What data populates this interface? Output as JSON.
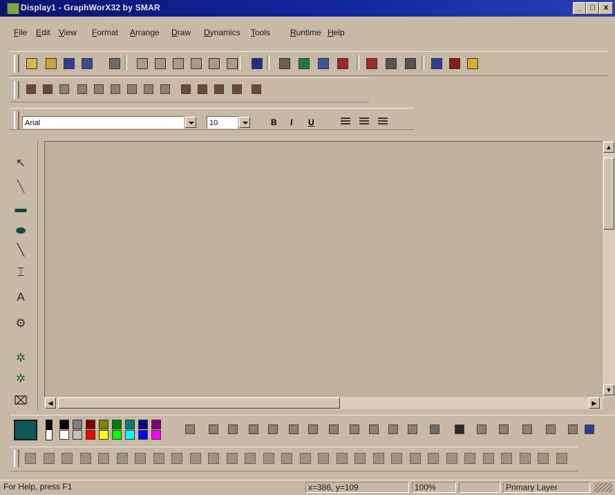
{
  "window": {
    "title": "Display1 - GraphWorX32 by SMAR",
    "buttons": {
      "minimize": "_",
      "maximize": "□",
      "close": "x"
    }
  },
  "menu": [
    {
      "label": "File",
      "ul": "F",
      "rest": "ile"
    },
    {
      "label": "Edit",
      "ul": "E",
      "rest": "dit"
    },
    {
      "label": "View",
      "ul": "V",
      "rest": "iew"
    },
    {
      "label": "Format",
      "ul": "F",
      "rest": "ormat"
    },
    {
      "label": "Arrange",
      "ul": "A",
      "rest": "rrange"
    },
    {
      "label": "Draw",
      "ul": "D",
      "rest": "raw"
    },
    {
      "label": "Dynamics",
      "ul": "D",
      "rest": "ynamics"
    },
    {
      "label": "Tools",
      "ul": "T",
      "rest": "ools"
    },
    {
      "label": "Runtime",
      "ul": "R",
      "rest": "untime"
    },
    {
      "label": "Help",
      "ul": "H",
      "rest": "elp"
    }
  ],
  "toolbars": {
    "standard": [
      "new-icon",
      "open-icon",
      "save-icon",
      "save-as-icon",
      "print-icon",
      "cut-icon",
      "copy-icon",
      "paste-icon",
      "paste-special-icon",
      "undo-icon",
      "redo-icon",
      "pointer-help-icon",
      "object-icon",
      "bar-chart-icon",
      "trend-icon",
      "alarm-icon",
      "gauge-icon",
      "switch-icon",
      "panel-icon",
      "runtime-icon",
      "display-icon",
      "lock-icon"
    ],
    "arrange": [
      "group-icon",
      "ungroup-icon",
      "align-icon",
      "front-icon",
      "back-icon",
      "flip-h-icon",
      "flip-v-icon",
      "rotate-icon",
      "rotate-left-icon",
      "pick-icon",
      "pick-2-icon",
      "layer-icon",
      "clear-icon",
      "grid-icon"
    ],
    "font": {
      "name": "Arial",
      "size": "10",
      "bold": "B",
      "italic": "I",
      "underline": "U"
    }
  },
  "palette": [
    "select-arrow-icon",
    "line-icon",
    "rectangle-icon",
    "ellipse-icon",
    "polyline-icon",
    "scale-icon",
    "text-icon",
    "symbol-icon",
    "puzzle-icon",
    "puzzle-2-icon",
    "button-icon"
  ],
  "colors": {
    "swatches": [
      "#000000",
      "#7f7f7f",
      "#800000",
      "#808000",
      "#008000",
      "#008080",
      "#000080",
      "#800080",
      "#ffffff",
      "#c0c0c0",
      "#ff0000",
      "#ffff00",
      "#00ff00",
      "#00ffff",
      "#0000ff",
      "#ff00ff"
    ],
    "current_fill": "#0f5a55",
    "current_line": "#000000"
  },
  "status": {
    "help": "For Help, press F1",
    "coords": "x=386, y=109",
    "zoom": "100%",
    "layer": "Primary Layer"
  }
}
